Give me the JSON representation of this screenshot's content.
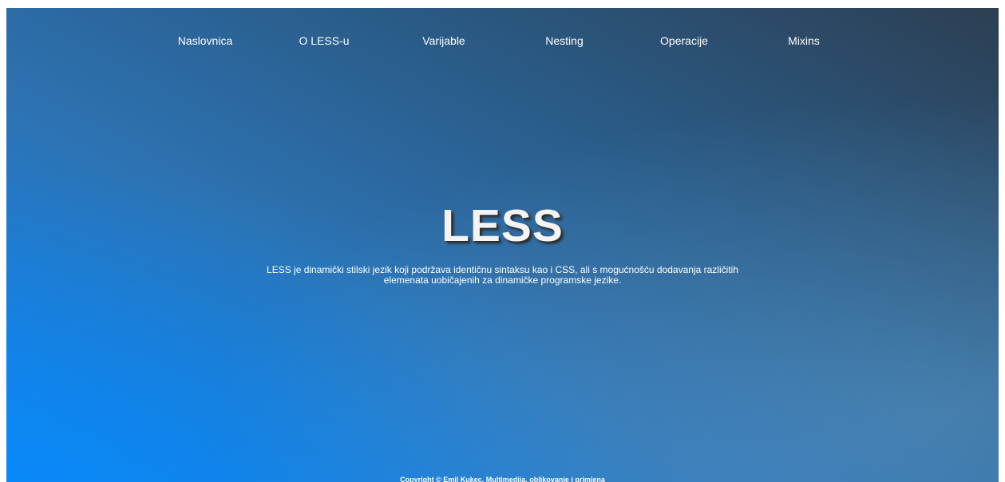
{
  "nav": {
    "items": [
      {
        "label": "Naslovnica"
      },
      {
        "label": "O LESS-u"
      },
      {
        "label": "Varijable"
      },
      {
        "label": "Nesting"
      },
      {
        "label": "Operacije"
      },
      {
        "label": "Mixins"
      }
    ]
  },
  "hero": {
    "title": "LESS",
    "description": "LESS je dinamički stilski jezik koji podržava identičnu sintaksu kao i CSS, ali s mogućnošću dodavanja različitih elemenata uobičajenih za dinamičke programske jezike."
  },
  "footer": {
    "copyright": "Copyright © Emil Kukec. Multimedija, oblikovanje i primjena"
  },
  "colors": {
    "gradient_start": "#0f86f5",
    "gradient_end": "#2d3f52",
    "text": "#ffffff"
  }
}
